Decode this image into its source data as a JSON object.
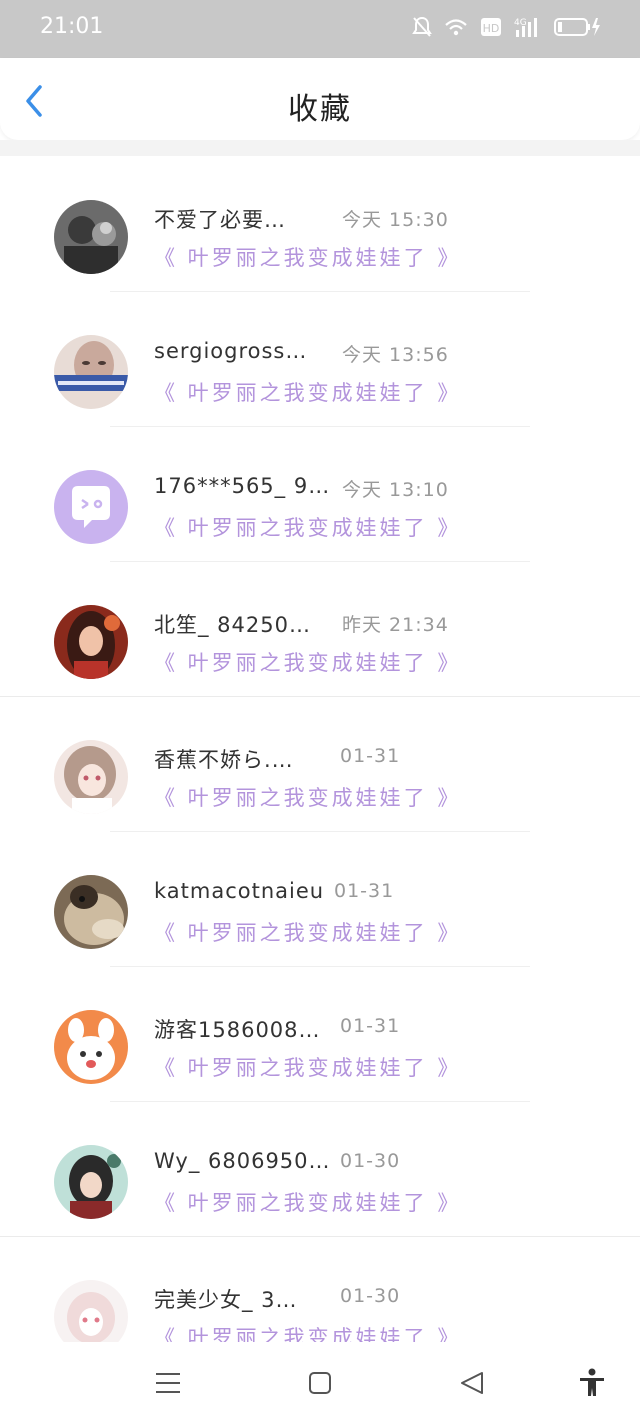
{
  "status": {
    "time": "21:01",
    "icons": [
      "mute-bell-icon",
      "wifi-icon",
      "hd-icon",
      "4g-signal-icon",
      "battery-charging-icon"
    ],
    "hd_label": "HD",
    "net_label": "4G"
  },
  "header": {
    "title": "收藏"
  },
  "colors": {
    "accent": "#3b8fe8",
    "work_title": "#b394dc",
    "status_bar": "#c8c8c8"
  },
  "items": [
    {
      "name": "不爱了必要…",
      "time": "今天 15:30",
      "work": "《 叶罗丽之我变成娃娃了 》"
    },
    {
      "name": "sergiogross…",
      "time": "今天 13:56",
      "work": "《 叶罗丽之我变成娃娃了 》"
    },
    {
      "name": "176***565_ 9…",
      "time": "今天 13:10",
      "work": "《 叶罗丽之我变成娃娃了 》"
    },
    {
      "name": "北笙_ 84250…",
      "time": "昨天 21:34",
      "work": "《 叶罗丽之我变成娃娃了 》"
    },
    {
      "name": "香蕉不娇ら.…",
      "time": "01-31",
      "work": "《 叶罗丽之我变成娃娃了 》"
    },
    {
      "name": "katmacotnaieu",
      "time": "01-31",
      "work": "《 叶罗丽之我变成娃娃了 》"
    },
    {
      "name": "游客1586008…",
      "time": "01-31",
      "work": "《 叶罗丽之我变成娃娃了 》"
    },
    {
      "name": "Wy_ 6806950…",
      "time": "01-30",
      "work": "《 叶罗丽之我变成娃娃了 》"
    },
    {
      "name": "完美少女_ 3…",
      "time": "01-30",
      "work": "《 叶罗丽之我变成娃娃了 》"
    }
  ],
  "nav": {
    "icons": [
      "menu-icon",
      "home-square-icon",
      "back-triangle-icon",
      "accessibility-icon"
    ]
  }
}
